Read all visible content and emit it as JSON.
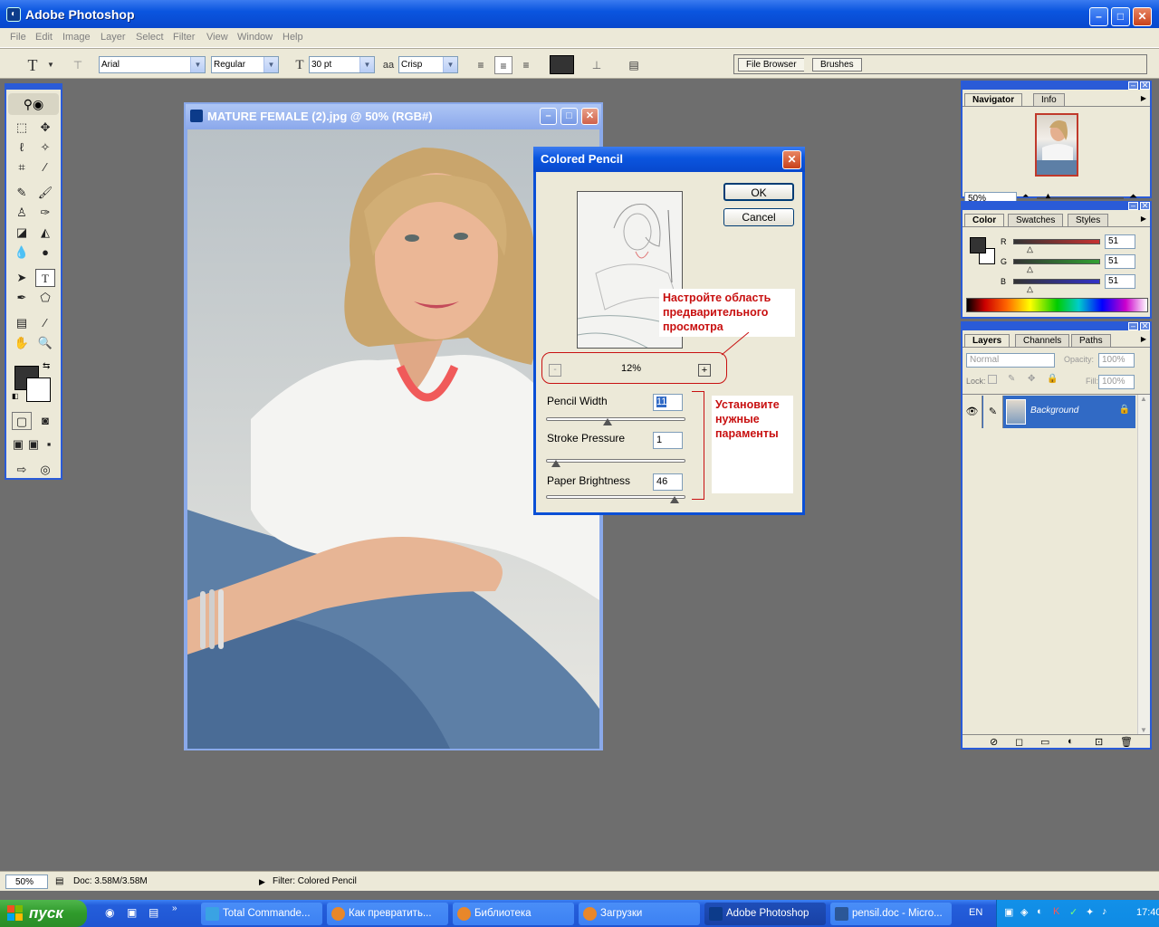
{
  "app": {
    "title": "Adobe Photoshop"
  },
  "menu": [
    "File",
    "Edit",
    "Image",
    "Layer",
    "Select",
    "Filter",
    "View",
    "Window",
    "Help"
  ],
  "options_bar": {
    "font_family": "Arial",
    "font_style": "Regular",
    "font_size": "30 pt",
    "antialias": "Crisp",
    "palette_well_tabs": [
      "File Browser",
      "Brushes"
    ]
  },
  "document": {
    "title": "MATURE FEMALE (2).jpg @ 50% (RGB#)"
  },
  "dialog": {
    "title": "Colored Pencil",
    "ok_label": "OK",
    "cancel_label": "Cancel",
    "zoom": "12%",
    "zoom_minus": "-",
    "zoom_plus": "+",
    "params": [
      {
        "label": "Pencil Width",
        "value": "11",
        "fraction": 0.44
      },
      {
        "label": "Stroke Pressure",
        "value": "1",
        "fraction": 0.07
      },
      {
        "label": "Paper Brightness",
        "value": "46",
        "fraction": 0.92
      }
    ],
    "callout_preview": "Настройте область предварительного просмотра",
    "callout_params": "Установите нужные параменты"
  },
  "navigator": {
    "tabs": [
      "Navigator",
      "Info"
    ],
    "zoom": "50%"
  },
  "color_panel": {
    "tabs": [
      "Color",
      "Swatches",
      "Styles"
    ],
    "channels": [
      {
        "label": "R",
        "value": "51",
        "color": "#c83232"
      },
      {
        "label": "G",
        "value": "51",
        "color": "#32a032"
      },
      {
        "label": "B",
        "value": "51",
        "color": "#3232c8"
      }
    ]
  },
  "layers_panel": {
    "tabs": [
      "Layers",
      "Channels",
      "Paths"
    ],
    "blend_mode": "Normal",
    "opacity_label": "Opacity:",
    "opacity": "100%",
    "lock_label": "Lock:",
    "fill_label": "Fill:",
    "fill": "100%",
    "layers": [
      {
        "name": "Background"
      }
    ]
  },
  "status_bar": {
    "zoom": "50%",
    "doc_info": "Doc: 3.58M/3.58M",
    "filter_info": "Filter: Colored Pencil"
  },
  "taskbar": {
    "start_label": "пуск",
    "tasks": [
      {
        "label": "Total Commande..."
      },
      {
        "label": "Как превратить..."
      },
      {
        "label": "Библиотека"
      },
      {
        "label": "Загрузки"
      },
      {
        "label": "Adobe Photoshop"
      },
      {
        "label": "pensil.doc - Micro..."
      }
    ],
    "language": "EN",
    "clock": "17:40"
  },
  "colors": {
    "xp_blue": "#0a55df",
    "callout_red": "#c81010",
    "canvas_gray": "#6e6e6e",
    "layer_selected": "#316ac5"
  }
}
